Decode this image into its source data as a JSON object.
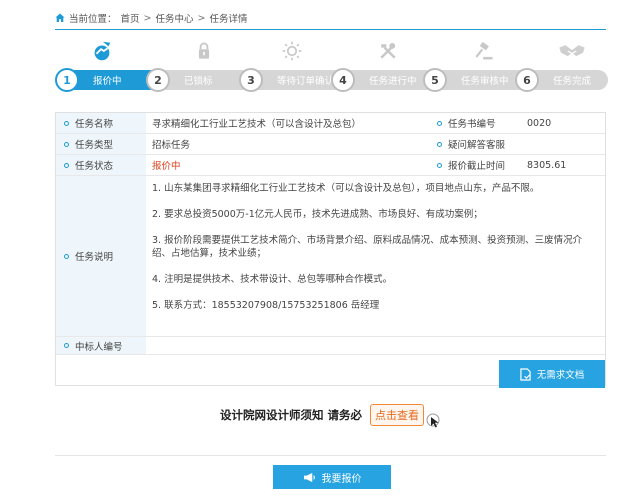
{
  "breadcrumb": {
    "prefix": "当前位置：",
    "home": "首页",
    "sep1": ">",
    "center": "任务中心",
    "sep2": ">",
    "current": "任务详情"
  },
  "steps": [
    {
      "num": "1",
      "label": "报价中",
      "icon": "handshake-blue-icon"
    },
    {
      "num": "2",
      "label": "已锁标",
      "icon": "lock-icon"
    },
    {
      "num": "3",
      "label": "等待订单确认",
      "icon": "sun-icon"
    },
    {
      "num": "4",
      "label": "任务进行中",
      "icon": "tools-icon"
    },
    {
      "num": "5",
      "label": "任务审核中",
      "icon": "gavel-icon"
    },
    {
      "num": "6",
      "label": "任务完成",
      "icon": "handshake-icon"
    }
  ],
  "details": {
    "name_label": "任务名称",
    "name_value": "寻求精细化工行业工艺技术（可以含设计及总包）",
    "code_label": "任务书编号",
    "code_value": "0020",
    "type_label": "任务类型",
    "type_value": "招标任务",
    "qa_label": "疑问解答客服",
    "qa_value": "",
    "status_label": "任务状态",
    "status_value": "报价中",
    "deadline_label": "报价截止时间",
    "deadline_value": "8305.61",
    "desc_label": "任务说明",
    "desc_lines": [
      "1. 山东某集团寻求精细化工行业工艺技术（可以含设计及总包），项目地点山东，产品不限。",
      "2. 要求总投资5000万-1亿元人民币，技术先进成熟、市场良好、有成功案例；",
      "3. 报价阶段需要提供工艺技术简介、市场背景介绍、原料成品情况、成本预测、投资预测、三废情况介绍、占地估算，技术业绩；",
      "4. 注明是提供技术、技术带设计、总包等哪种合作模式。",
      "5. 联系方式：18553207908/15753251806 岳经理"
    ],
    "winner_label": "中标人编号",
    "winner_value": ""
  },
  "doc_button": "无需求文档",
  "notice": {
    "text": "设计院网设计师须知 请务必",
    "button": "点击查看"
  },
  "quote_button": "我要报价",
  "colors": {
    "accent": "#1e9bd7",
    "button": "#26a3e0",
    "status_red": "#e0421f",
    "orange": "#f0883a"
  }
}
